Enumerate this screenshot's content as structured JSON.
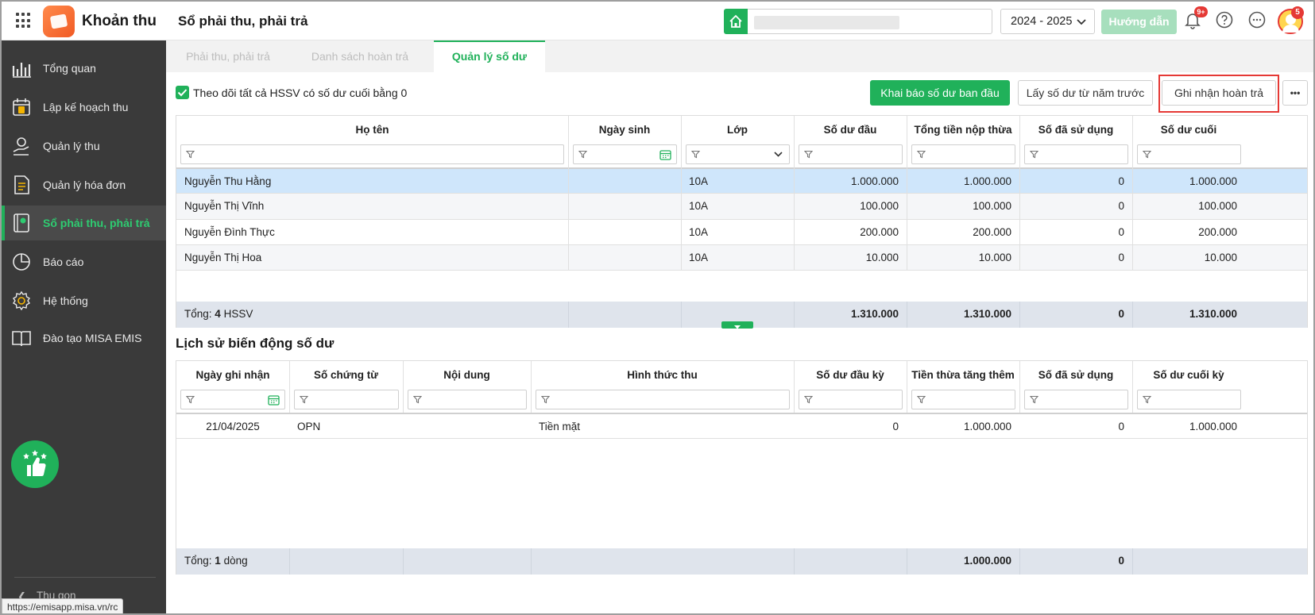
{
  "app": {
    "name": "Khoản thu",
    "page_title": "Sổ phải thu, phải trả"
  },
  "header": {
    "school_value": "",
    "year": "2024 - 2025",
    "guide_label": "Hướng dẫn",
    "notification_badge": "9+",
    "avatar_badge": "5"
  },
  "sidebar": {
    "items": [
      {
        "label": "Tổng quan",
        "icon": "chart-icon"
      },
      {
        "label": "Lập kế hoạch thu",
        "icon": "calendar-money-icon"
      },
      {
        "label": "Quản lý thu",
        "icon": "hand-money-icon"
      },
      {
        "label": "Quản lý hóa đơn",
        "icon": "invoice-icon"
      },
      {
        "label": "Sổ phải thu, phải trả",
        "icon": "ledger-icon",
        "active": true
      },
      {
        "label": "Báo cáo",
        "icon": "pie-chart-icon"
      },
      {
        "label": "Hệ thống",
        "icon": "gear-icon"
      },
      {
        "label": "Đào tạo MISA EMIS",
        "icon": "book-icon"
      }
    ],
    "collapse_label": "Thu gọn",
    "status_url": "https://emisapp.misa.vn/rc"
  },
  "tabs": [
    {
      "label": "Phải thu, phải trả"
    },
    {
      "label": "Danh sách hoàn trả"
    },
    {
      "label": "Quản lý số dư",
      "active": true
    }
  ],
  "toolbar": {
    "checkbox_label": "Theo dõi tất cả HSSV có số dư cuối bằng 0",
    "checkbox_checked": true,
    "btn_declare": "Khai báo số dư ban đầu",
    "btn_fetch": "Lấy số dư từ năm trước",
    "btn_record": "Ghi nhận hoàn trả",
    "btn_more": "•••"
  },
  "balance_table": {
    "columns": [
      "Họ tên",
      "Ngày sinh",
      "Lớp",
      "Số dư đầu",
      "Tổng tiền nộp thừa",
      "Số đã sử dụng",
      "Số dư cuối"
    ],
    "rows": [
      [
        "Nguyễn Thu Hằng",
        "",
        "10A",
        "1.000.000",
        "1.000.000",
        "0",
        "1.000.000"
      ],
      [
        "Nguyễn Thị Vĩnh",
        "",
        "10A",
        "100.000",
        "100.000",
        "0",
        "100.000"
      ],
      [
        "Nguyễn Đình Thực",
        "",
        "10A",
        "200.000",
        "200.000",
        "0",
        "200.000"
      ],
      [
        "Nguyễn Thị Hoa",
        "",
        "10A",
        "10.000",
        "10.000",
        "0",
        "10.000"
      ]
    ],
    "footer": {
      "prefix": "Tổng:",
      "count": "4",
      "unit": "HSSV",
      "values": [
        "1.310.000",
        "1.310.000",
        "0",
        "1.310.000"
      ]
    }
  },
  "history": {
    "title": "Lịch sử biến động số dư",
    "columns": [
      "Ngày ghi nhận",
      "Số chứng từ",
      "Nội dung",
      "Hình thức thu",
      "Số dư đầu kỳ",
      "Tiền thừa tăng thêm",
      "Số đã sử dụng",
      "Số dư cuối kỳ"
    ],
    "rows": [
      [
        "21/04/2025",
        "OPN",
        "",
        "Tiền mặt",
        "0",
        "1.000.000",
        "0",
        "1.000.000"
      ]
    ],
    "footer": {
      "prefix": "Tổng:",
      "count": "1",
      "unit": "dòng",
      "values": [
        "",
        "1.000.000",
        "0",
        ""
      ]
    }
  },
  "colors": {
    "brand_green": "#20b15a",
    "sidebar_bg": "#3a3a3a",
    "highlight_red": "#e53935"
  }
}
